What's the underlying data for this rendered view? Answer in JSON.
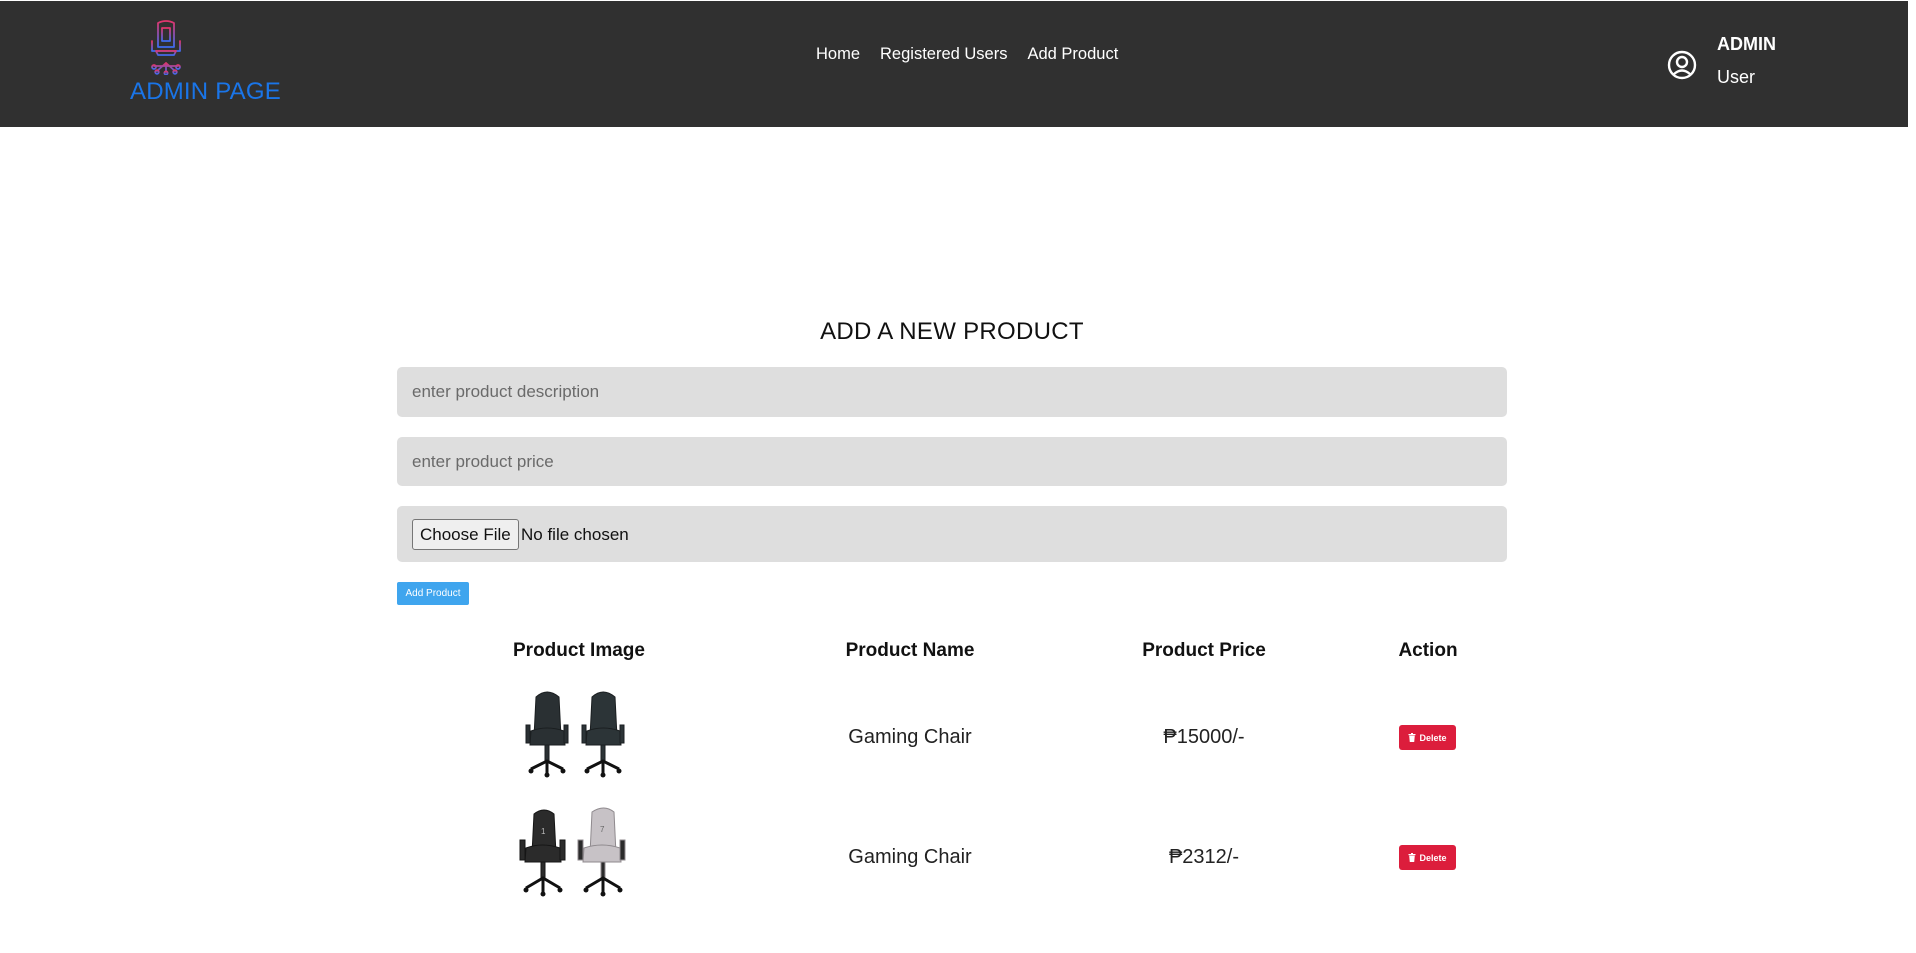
{
  "header": {
    "brand_title": "ADMIN PAGE",
    "logo_icon": "gaming-chair-logo",
    "nav": [
      {
        "label": "Home"
      },
      {
        "label": "Registered Users"
      },
      {
        "label": "Add Product"
      }
    ],
    "user_icon": "user-circle-icon",
    "user_role": "ADMIN",
    "user_name": "User"
  },
  "form": {
    "title": "ADD A NEW PRODUCT",
    "description_placeholder": "enter product description",
    "description_value": "",
    "price_placeholder": "enter product price",
    "price_value": "",
    "file_button_label": "Choose File",
    "file_status": "No file chosen",
    "submit_label": "Add Product"
  },
  "table": {
    "headers": [
      "Product Image",
      "Product Name",
      "Product Price",
      "Action"
    ],
    "rows": [
      {
        "image_icon": "two-dark-gaming-chairs",
        "name": "Gaming Chair",
        "price": "₱15000/-",
        "action_label": "Delete",
        "action_icon": "trash-icon"
      },
      {
        "image_icon": "black-and-grey-gaming-chairs",
        "name": "Gaming Chair",
        "price": "₱2312/-",
        "action_label": "Delete",
        "action_icon": "trash-icon"
      }
    ]
  },
  "colors": {
    "topbar": "#303030",
    "brand": "#1a75e8",
    "input_bg": "#dedede",
    "add_button": "#3fa5ee",
    "delete_button": "#dc1d3c"
  }
}
